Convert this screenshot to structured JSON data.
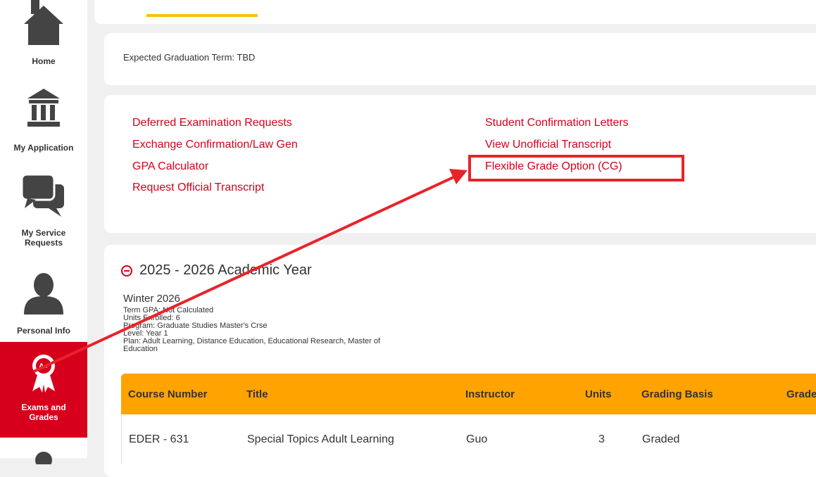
{
  "sidebar": {
    "items": [
      {
        "label": "Home",
        "icon": "home-icon"
      },
      {
        "label": "My Application",
        "icon": "institution-icon"
      },
      {
        "label": "My Service Requests",
        "icon": "chat-bubbles-icon"
      },
      {
        "label": "Personal Info",
        "icon": "person-icon"
      },
      {
        "label": "Exams and Grades",
        "icon": "award-ribbon-icon",
        "badge": "A+"
      }
    ]
  },
  "graduation": {
    "text": "Expected Graduation Term: TBD"
  },
  "links": {
    "col1": [
      "Deferred Examination Requests",
      "Exchange Confirmation/Law Gen",
      "GPA Calculator",
      "Request Official Transcript"
    ],
    "col2": [
      "Student Confirmation Letters",
      "View Unofficial Transcript",
      "Flexible Grade Option (CG)"
    ]
  },
  "academic_year": {
    "title": "2025 - 2026 Academic Year",
    "term": "Winter 2026",
    "lines": [
      "Term GPA: Not Calculated",
      "Units Enrolled: 6",
      "Program: Graduate Studies Master's Crse",
      "Level: Year 1",
      "Plan: Adult Learning, Distance Education, Educational Research, Master of",
      "Education"
    ]
  },
  "table": {
    "headers": [
      "Course Number",
      "Title",
      "Instructor",
      "Units",
      "Grading Basis",
      "Grade"
    ],
    "rows": [
      [
        "EDER - 631",
        "Special Topics Adult Learning",
        "Guo",
        "3",
        "Graded",
        ""
      ]
    ]
  },
  "colors": {
    "accent": "#d6001c",
    "table_header": "#ffa300",
    "tab_indicator": "#f5c400"
  }
}
